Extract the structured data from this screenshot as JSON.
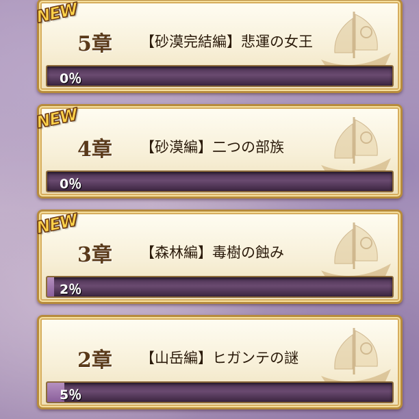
{
  "chapters": [
    {
      "new_badge": "NEW",
      "number": "5章",
      "title": "【砂漠完結編】悲運の女王",
      "progress_text": "0％",
      "progress": 0
    },
    {
      "new_badge": "NEW",
      "number": "4章",
      "title": "【砂漠編】二つの部族",
      "progress_text": "0％",
      "progress": 0
    },
    {
      "new_badge": "NEW",
      "number": "3章",
      "title": "【森林編】毒樹の蝕み",
      "progress_text": "2％",
      "progress": 0.02
    },
    {
      "new_badge": "",
      "number": "2章",
      "title": "【山岳編】ヒガンテの謎",
      "progress_text": "5％",
      "progress": 0.05
    }
  ],
  "icons": {
    "card_decoration": "sailing-ship-icon",
    "badge": "new-badge"
  },
  "colors": {
    "frame": "#b78b3c",
    "progress_track": "#4a3152",
    "chapter_text": "#5a3a1a"
  }
}
